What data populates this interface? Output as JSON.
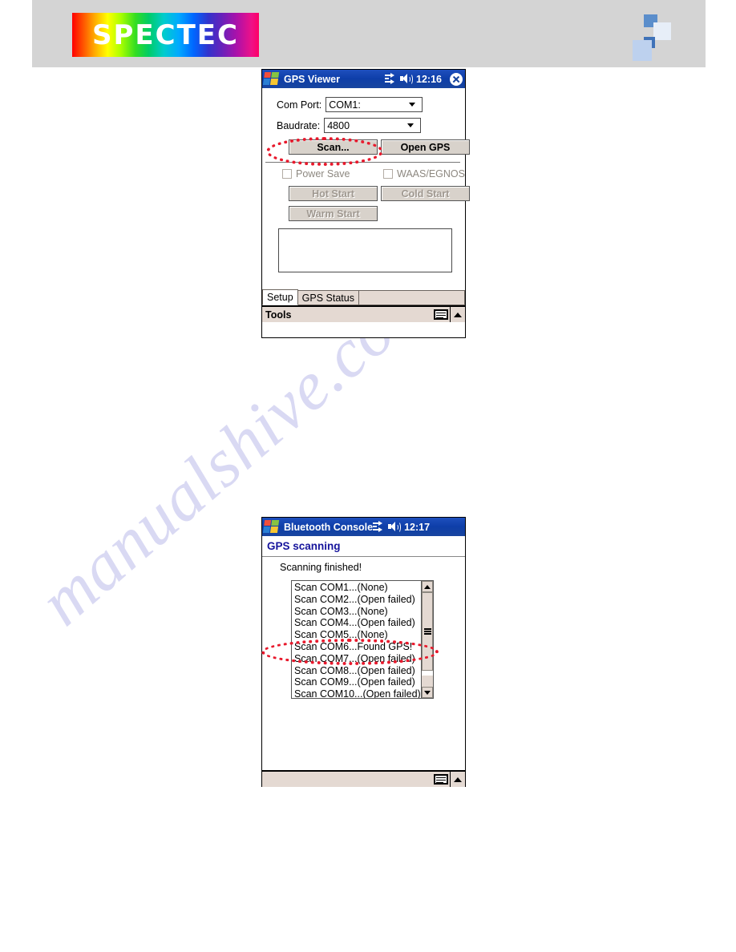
{
  "header": {
    "logo_text": "SPECTEC",
    "deco_icon": "blue-squares-decoration"
  },
  "watermark": {
    "text": "manualshive.com"
  },
  "gps_viewer": {
    "titlebar": {
      "start_icon": "windows-flag-icon",
      "title": "GPS Viewer",
      "connect_icon": "connectivity-icon",
      "speaker_icon": "speaker-icon",
      "time": "12:16",
      "close_icon": "close-icon"
    },
    "com_port": {
      "label": "Com Port:",
      "value": "COM1:"
    },
    "baudrate": {
      "label": "Baudrate:",
      "value": "4800"
    },
    "buttons": {
      "scan": "Scan...",
      "open_gps": "Open GPS",
      "hot_start": "Hot Start",
      "cold_start": "Cold Start",
      "warm_start": "Warm Start"
    },
    "checkboxes": {
      "power_save": "Power Save",
      "waas_egnos": "WAAS/EGNOS"
    },
    "log_box": {
      "value": ""
    },
    "tabs": [
      {
        "label": "Setup",
        "active": true
      },
      {
        "label": "GPS Status",
        "active": false
      }
    ],
    "softbar": {
      "label": "Tools",
      "keyboard_icon": "keyboard-icon",
      "caret_icon": "up-caret-icon"
    }
  },
  "bluetooth_console": {
    "titlebar": {
      "start_icon": "windows-flag-icon",
      "title": "Bluetooth Console",
      "connect_icon": "connectivity-icon",
      "speaker_icon": "speaker-icon",
      "time": "12:17"
    },
    "heading": "GPS scanning",
    "status": "Scanning finished!",
    "scan_results": [
      "Scan COM1...(None)",
      "Scan COM2...(Open failed)",
      "Scan COM3...(None)",
      "Scan COM4...(Open failed)",
      "Scan COM5...(None)",
      "Scan COM6...Found GPS!",
      "Scan COM7...(Open failed)",
      "Scan COM8...(Open failed)",
      "Scan COM9...(Open failed)",
      "Scan COM10...(Open failed)"
    ],
    "scrollbar": {
      "up_icon": "scroll-up-arrow-icon",
      "down_icon": "scroll-down-arrow-icon",
      "thumb_icon": "scroll-thumb-grip"
    },
    "softbar": {
      "keyboard_icon": "keyboard-icon",
      "caret_icon": "up-caret-icon"
    }
  },
  "annotations": {
    "accent_color": "#e8192c",
    "scan_highlight": "ellipse-around-scan-button",
    "com6_highlight": "ellipse-around-com6-result"
  }
}
